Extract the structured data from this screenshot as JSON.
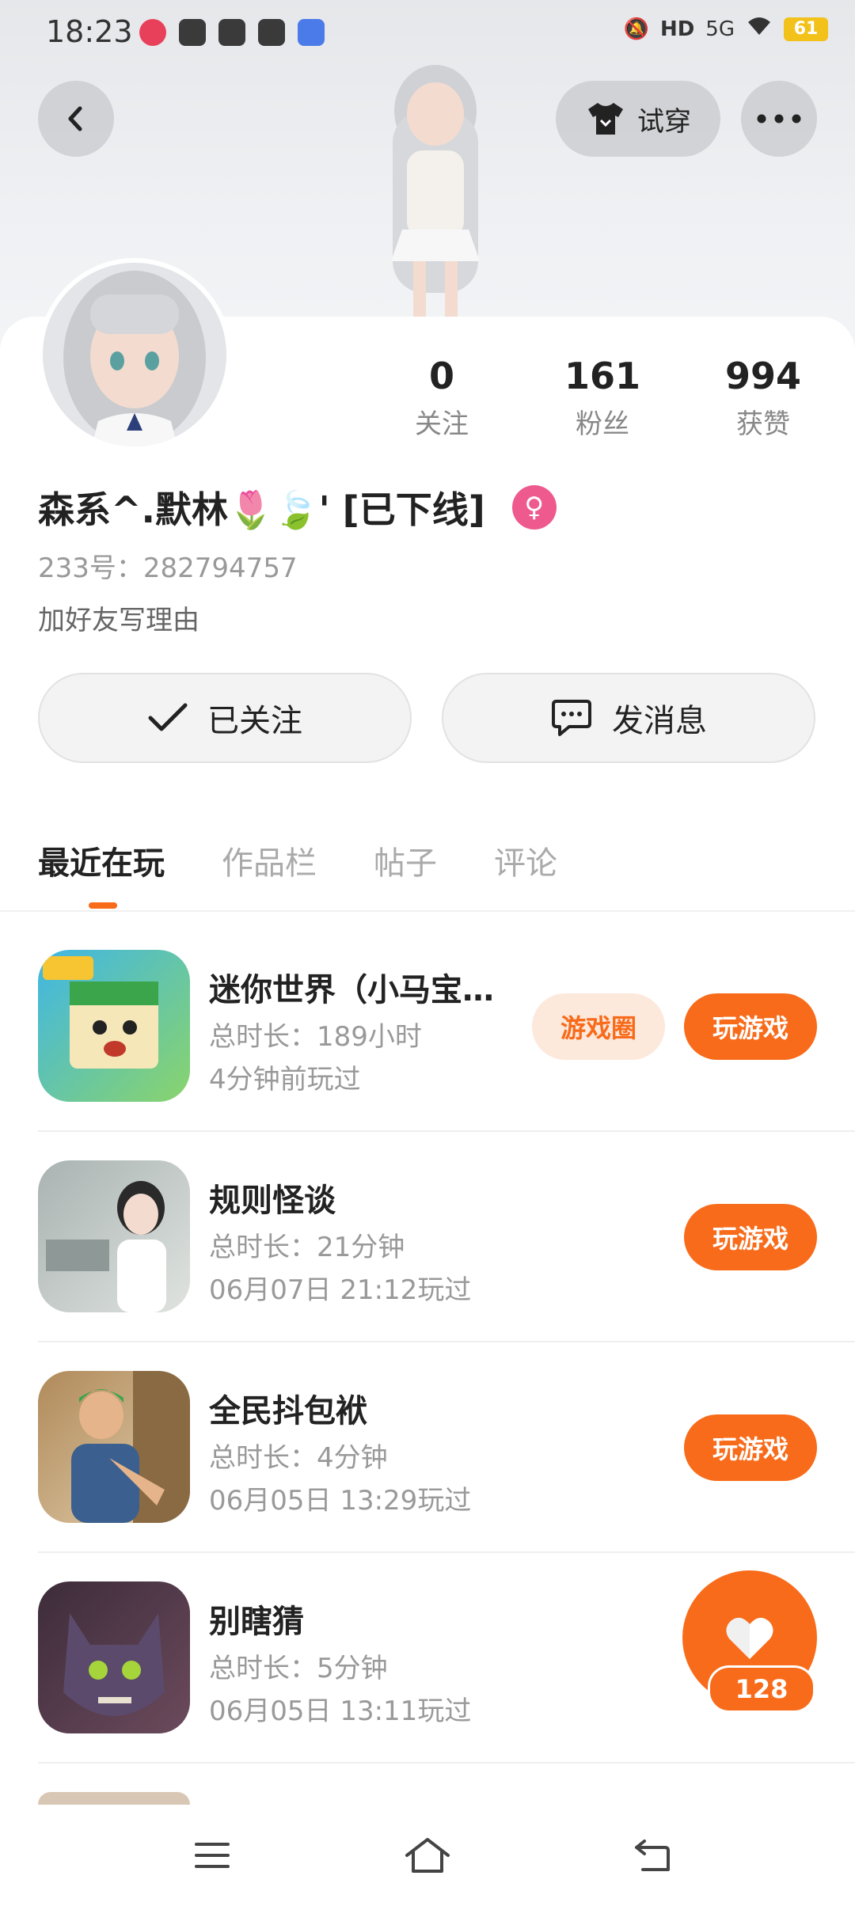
{
  "status_bar": {
    "time": "18:23",
    "network": "5G",
    "battery": "61"
  },
  "header": {
    "back_icon": "chevron-left-icon",
    "try_on_label": "试穿",
    "more_icon": "more-horizontal-icon"
  },
  "profile": {
    "nickname": "森系^.默林🌷🍃' [已下线]",
    "gender_icon": "female-icon",
    "uid_label": "233号：282794757",
    "add_friend_reason": "加好友写理由",
    "stats": [
      {
        "value": "0",
        "label": "关注"
      },
      {
        "value": "161",
        "label": "粉丝"
      },
      {
        "value": "994",
        "label": "获赞"
      }
    ]
  },
  "actions": {
    "followed_label": "已关注",
    "message_label": "发消息"
  },
  "tabs": [
    {
      "label": "最近在玩",
      "active": true
    },
    {
      "label": "作品栏",
      "active": false
    },
    {
      "label": "帖子",
      "active": false
    },
    {
      "label": "评论",
      "active": false
    }
  ],
  "games": [
    {
      "title": "迷你世界（小马宝…",
      "duration": "总时长：189小时",
      "last_played": "4分钟前玩过",
      "circle_label": "游戏圈",
      "play_label": "玩游戏"
    },
    {
      "title": "规则怪谈",
      "duration": "总时长：21分钟",
      "last_played": "06月07日  21:12玩过",
      "play_label": "玩游戏"
    },
    {
      "title": "全民抖包袱",
      "duration": "总时长：4分钟",
      "last_played": "06月05日  13:29玩过",
      "play_label": "玩游戏"
    },
    {
      "title": "别瞎猜",
      "duration": "总时长：5分钟",
      "last_played": "06月05日  13:11玩过"
    }
  ],
  "floating_like": {
    "count": "128",
    "icon": "heart-icon"
  },
  "colors": {
    "accent": "#f86b1a",
    "accent_light": "#fde8dc",
    "gender_pink": "#ee5a8e"
  }
}
